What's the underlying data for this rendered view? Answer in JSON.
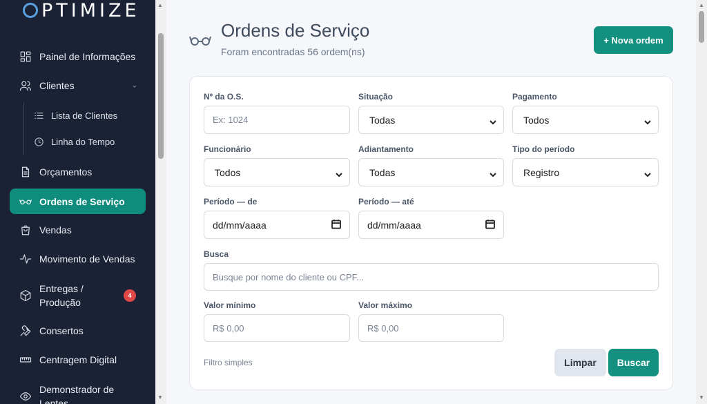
{
  "app": {
    "logo_text": "PTIMIZE"
  },
  "sidebar": {
    "items": [
      {
        "label": "Painel de Informações",
        "icon": "dashboard-icon"
      },
      {
        "label": "Clientes",
        "icon": "users-icon"
      },
      {
        "label": "Lista de Clientes",
        "icon": "list-icon"
      },
      {
        "label": "Linha do Tempo",
        "icon": "clock-icon"
      },
      {
        "label": "Orçamentos",
        "icon": "document-icon"
      },
      {
        "label": "Ordens de Serviço",
        "icon": "glasses-icon"
      },
      {
        "label": "Vendas",
        "icon": "shopping-bag-icon"
      },
      {
        "label": "Movimento de Vendas",
        "icon": "activity-icon"
      },
      {
        "label": "Entregas / Produção",
        "icon": "package-icon",
        "badge": "4"
      },
      {
        "label": "Consertos",
        "icon": "wrench-icon"
      },
      {
        "label": "Centragem Digital",
        "icon": "ruler-icon"
      },
      {
        "label": "Demonstrador de Lentes",
        "icon": "eye-icon"
      }
    ],
    "entregas_line1": "Entregas /",
    "entregas_line2": "Produção",
    "demo_line1": "Demonstrador de",
    "demo_line2": "Lentes"
  },
  "header": {
    "title": "Ordens de Serviço",
    "subtitle": "Foram encontradas 56 ordem(ns)",
    "new_button": "+ Nova ordem"
  },
  "filters": {
    "os_number": {
      "label": "Nº da O.S.",
      "placeholder": "Ex: 1024"
    },
    "situacao": {
      "label": "Situação",
      "value": "Todas"
    },
    "pagamento": {
      "label": "Pagamento",
      "value": "Todos"
    },
    "funcionario": {
      "label": "Funcionário",
      "value": "Todos"
    },
    "adiantamento": {
      "label": "Adiantamento",
      "value": "Todas"
    },
    "tipo_periodo": {
      "label": "Tipo do período",
      "value": "Registro"
    },
    "periodo_de": {
      "label": "Período — de",
      "value": "dd/mm/aaaa"
    },
    "periodo_ate": {
      "label": "Período — até",
      "value": "dd/mm/aaaa"
    },
    "busca": {
      "label": "Busca",
      "placeholder": "Busque por nome do cliente ou CPF..."
    },
    "valor_min": {
      "label": "Valor mínimo",
      "placeholder": "R$ 0,00"
    },
    "valor_max": {
      "label": "Valor máximo",
      "placeholder": "R$ 0,00"
    },
    "simple_filter": "Filtro simples",
    "clear_button": "Limpar",
    "search_button": "Buscar"
  },
  "colors": {
    "sidebar_bg": "#1b2236",
    "accent": "#13907f",
    "badge": "#e04848"
  }
}
